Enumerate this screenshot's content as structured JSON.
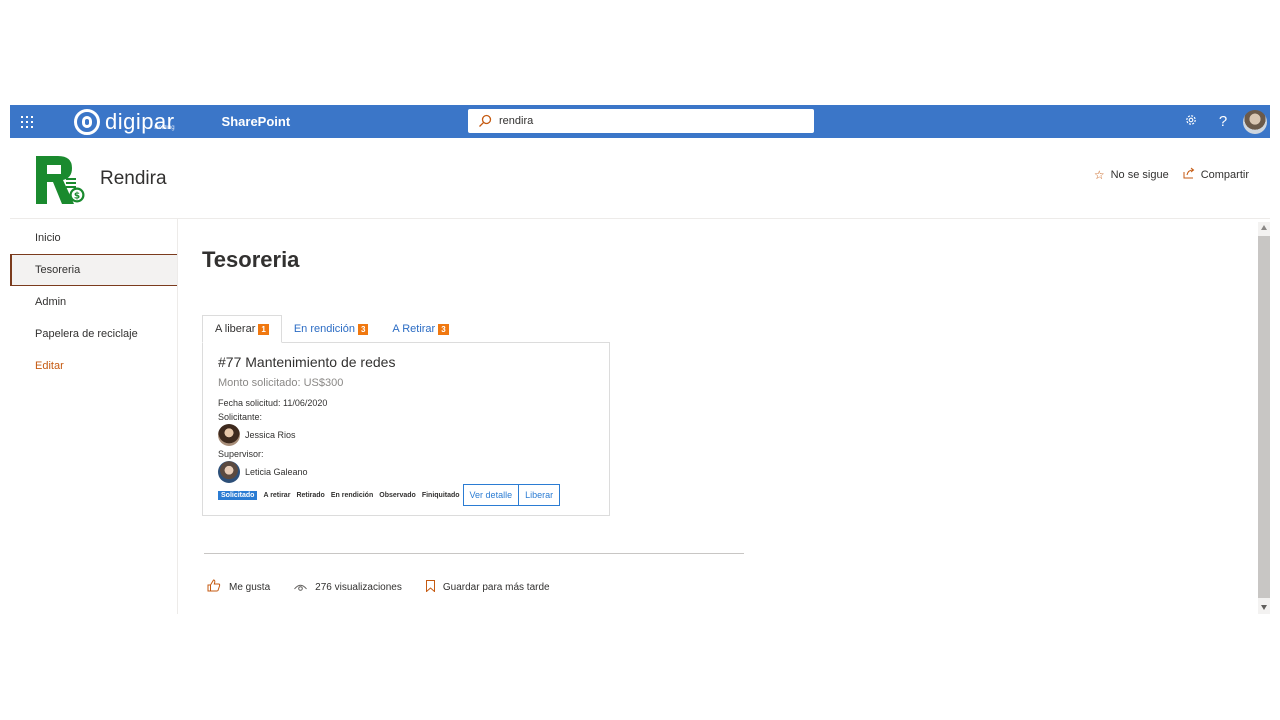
{
  "suitebar": {
    "brand_name": "digipar",
    "brand_sub": "Holding",
    "app_label": "SharePoint",
    "search_value": "rendira",
    "icons": [
      "waffle-icon",
      "search-icon",
      "gear-icon",
      "help-icon",
      "avatar"
    ],
    "help_label": "?"
  },
  "site": {
    "title": "Rendira",
    "follow_label": "No se sigue",
    "share_label": "Compartir"
  },
  "nav": {
    "items": [
      {
        "label": "Inicio"
      },
      {
        "label": "Tesoreria",
        "selected": true
      },
      {
        "label": "Admin"
      },
      {
        "label": "Papelera de reciclaje"
      }
    ],
    "edit_label": "Editar"
  },
  "page": {
    "title": "Tesoreria",
    "tabs": [
      {
        "label": "A liberar",
        "count": "1",
        "active": true
      },
      {
        "label": "En rendición",
        "count": "3"
      },
      {
        "label": "A Retirar",
        "count": "3"
      }
    ],
    "card": {
      "title": "#77 Mantenimiento de redes",
      "amount": "Monto solicitado: US$300",
      "date": "Fecha solicitud: 11/06/2020",
      "requester_label": "Solicitante:",
      "requester_name": "Jessica Rios",
      "supervisor_label": "Supervisor:",
      "supervisor_name": "Leticia Galeano",
      "statuses": [
        "Solicitado",
        "A retirar",
        "Retirado",
        "En rendición",
        "Observado",
        "Finiquitado"
      ],
      "detail_button": "Ver detalle",
      "release_button": "Liberar"
    },
    "social": {
      "like_label": "Me gusta",
      "views_label": "276 visualizaciones",
      "save_label": "Guardar para más tarde"
    }
  },
  "colors": {
    "suitebar": "#3b76c8",
    "accent_orange": "#c55a11",
    "badge_orange": "#f07810",
    "link_blue": "#2b7cd3",
    "logo_green": "#1a8a2e"
  }
}
